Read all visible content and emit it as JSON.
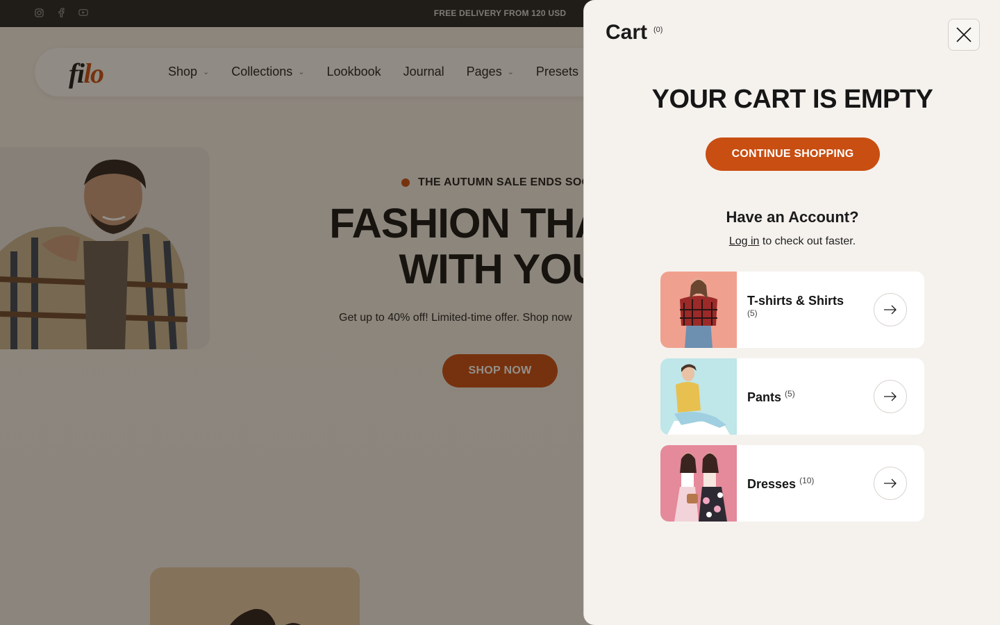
{
  "topbar": {
    "promo": "FREE DELIVERY FROM 120 USD",
    "socials": [
      "instagram-icon",
      "facebook-icon",
      "youtube-icon"
    ]
  },
  "header": {
    "logo_main": "fi",
    "logo_accent": "lo",
    "nav": [
      {
        "label": "Shop",
        "has_dropdown": true
      },
      {
        "label": "Collections",
        "has_dropdown": true
      },
      {
        "label": "Lookbook",
        "has_dropdown": false
      },
      {
        "label": "Journal",
        "has_dropdown": false
      },
      {
        "label": "Pages",
        "has_dropdown": true
      },
      {
        "label": "Presets",
        "has_dropdown": false
      }
    ]
  },
  "hero": {
    "eyebrow": "THE AUTUMN SALE ENDS SOO",
    "title_line1": "FASHION THAT M",
    "title_line2": "WITH YOU",
    "subtitle": "Get up to 40% off! Limited-time offer. Shop now",
    "cta": "SHOP NOW"
  },
  "cart": {
    "title": "Cart",
    "count": "(0)",
    "empty_title": "YOUR CART IS EMPTY",
    "continue_label": "CONTINUE SHOPPING",
    "account_title": "Have an Account?",
    "login_link": "Log in",
    "login_suffix": " to check out faster.",
    "categories": [
      {
        "name": "T-shirts & Shirts",
        "count": "(5)"
      },
      {
        "name": "Pants",
        "count": "(5)"
      },
      {
        "name": "Dresses",
        "count": "(10)"
      }
    ]
  },
  "colors": {
    "accent": "#c84e12",
    "topbar": "#232323",
    "drawer_bg": "#f5f2ee"
  }
}
